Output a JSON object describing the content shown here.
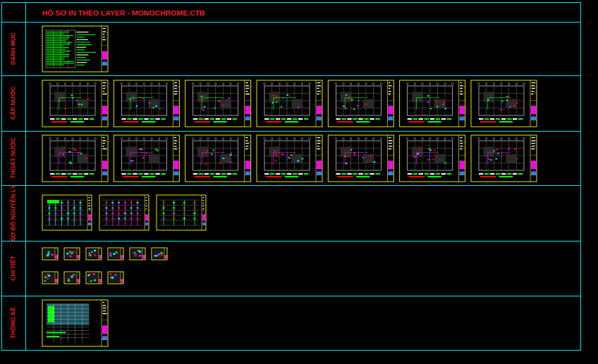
{
  "window": {
    "title": "HỒ SƠ IN THEO LAYER - MONOCHROME.CTB"
  },
  "colors": {
    "background": "#000000",
    "frame": "#00e5e5",
    "title": "#ff2020",
    "label": "#ff2020",
    "sheet_border": "#ffff00",
    "sheet_inner": "#ffffff",
    "green": "#00ff00",
    "magenta": "#ff00ff",
    "red": "#ff0000",
    "blue": "#3b7bff",
    "cyan": "#00ffff",
    "gray": "#8a8a8a"
  },
  "rows": [
    {
      "id": "danh-muc",
      "label": "DANH MỤC",
      "sheet_groups": [
        {
          "kind": "index",
          "count": 1
        }
      ]
    },
    {
      "id": "cap-nuoc",
      "label": "CẤP NƯỚC",
      "sheet_groups": [
        {
          "kind": "plan",
          "count": 7
        }
      ]
    },
    {
      "id": "thoat-nuoc",
      "label": "THOÁT NƯỚC",
      "sheet_groups": [
        {
          "kind": "plan",
          "count": 7
        }
      ]
    },
    {
      "id": "so-do-nguyen-ly",
      "label": "SƠ ĐỒ NGUYÊN LÝ",
      "sheet_groups": [
        {
          "kind": "riser",
          "count": 3
        }
      ]
    },
    {
      "id": "chi-tiet",
      "label": "CHI TIẾT",
      "sheet_groups": [
        {
          "kind": "detail",
          "count": 6
        },
        {
          "kind": "detail",
          "count": 4
        }
      ]
    },
    {
      "id": "thong-ke",
      "label": "THỐNG KÊ",
      "sheet_groups": [
        {
          "kind": "table",
          "count": 1
        }
      ]
    }
  ]
}
